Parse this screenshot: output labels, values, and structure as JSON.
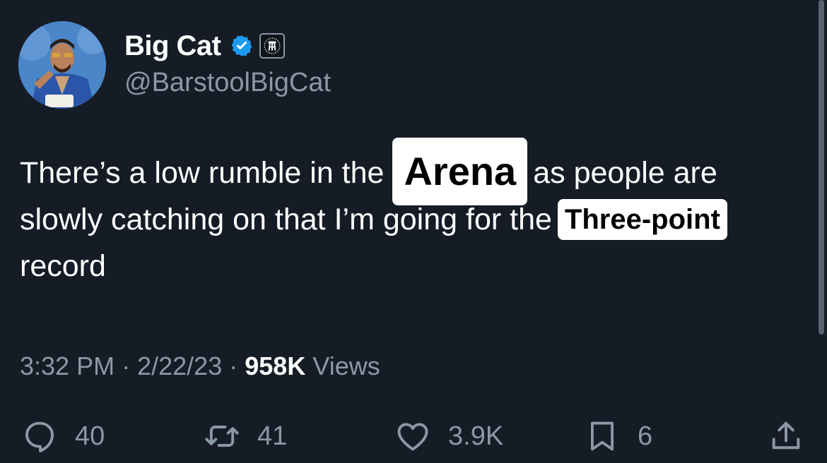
{
  "author": {
    "display_name": "Big Cat",
    "handle": "@BarstoolBigCat",
    "verified_icon": "verified-badge-icon",
    "affiliation_icon": "barstool-logo-icon"
  },
  "tweet": {
    "line1_before": "There’s a low rumble in the",
    "highlight1": "Arena",
    "line1_after": "as people are",
    "line2_before": "slowly catching on that I’m going for the",
    "highlight2": "Three-point",
    "line3": "record"
  },
  "meta": {
    "time": "3:32 PM",
    "sep1": "·",
    "date": "2/22/23",
    "sep2": "·",
    "views_count": "958K",
    "views_label": "Views"
  },
  "actions": {
    "replies": "40",
    "retweets": "41",
    "likes": "3.9K",
    "bookmarks": "6"
  },
  "colors": {
    "background": "#161c26",
    "text": "#ffffff",
    "secondary": "#8b98a5",
    "verified": "#1d9bf0"
  }
}
